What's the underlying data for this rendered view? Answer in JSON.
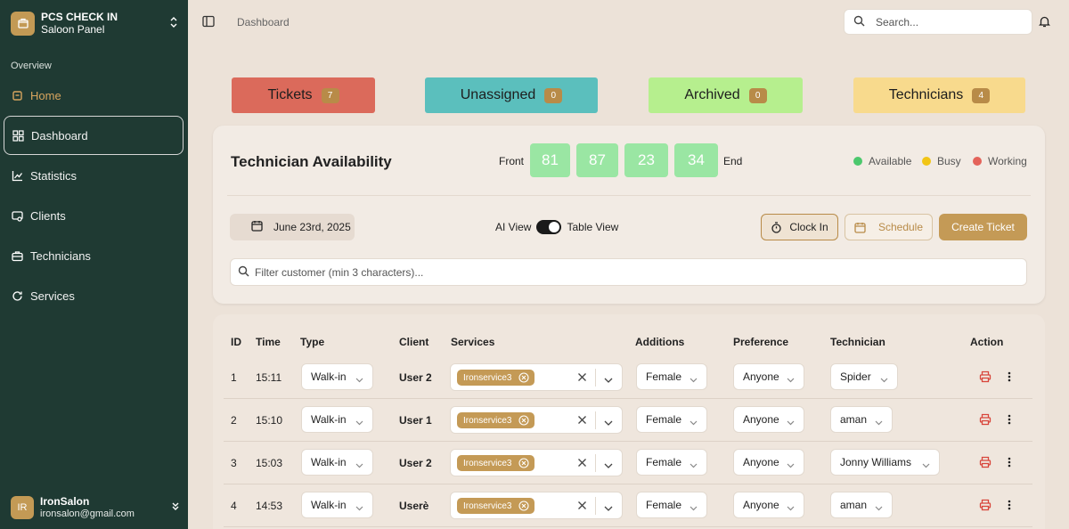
{
  "brand": {
    "title": "PCS CHECK IN",
    "subtitle": "Saloon Panel"
  },
  "sidebar": {
    "section": "Overview",
    "items": [
      {
        "label": "Home",
        "icon": "home-icon"
      },
      {
        "label": "Dashboard",
        "icon": "dashboard-icon"
      },
      {
        "label": "Statistics",
        "icon": "chart-icon"
      },
      {
        "label": "Clients",
        "icon": "clients-icon"
      },
      {
        "label": "Technicians",
        "icon": "briefcase-icon"
      },
      {
        "label": "Services",
        "icon": "services-icon"
      }
    ],
    "active": "Dashboard"
  },
  "user": {
    "initials": "IR",
    "name": "IronSalon",
    "email": "ironsalon@gmail.com"
  },
  "header": {
    "breadcrumb": "Dashboard",
    "search_placeholder": "Search..."
  },
  "stats": [
    {
      "label": "Tickets",
      "count": "7",
      "color": "#db6a5b"
    },
    {
      "label": "Unassigned",
      "count": "0",
      "color": "#5bbfbd"
    },
    {
      "label": "Archived",
      "count": "0",
      "color": "#b6ef8e"
    },
    {
      "label": "Technicians",
      "count": "4",
      "color": "#f8da8d"
    }
  ],
  "availability": {
    "title": "Technician Availability",
    "front_label": "Front",
    "end_label": "End",
    "queue": [
      "81",
      "87",
      "23",
      "34"
    ],
    "legend": [
      {
        "label": "Available",
        "color": "#4cc86d"
      },
      {
        "label": "Busy",
        "color": "#f2c515"
      },
      {
        "label": "Working",
        "color": "#e4635a"
      }
    ],
    "date": "June 23rd, 2025",
    "ai_view": "AI View",
    "table_view": "Table View",
    "clock_in": "Clock In",
    "schedule": "Schedule",
    "create_ticket": "Create Ticket",
    "filter_placeholder": "Filter customer (min 3 characters)..."
  },
  "table": {
    "headers": [
      "ID",
      "Time",
      "Type",
      "Client",
      "Services",
      "Additions",
      "Preference",
      "Technician",
      "Action"
    ],
    "rows": [
      {
        "id": "1",
        "time": "15:11",
        "type": "Walk-in",
        "client": "User 2",
        "service": "Ironservice3",
        "addition": "Female",
        "preference": "Anyone",
        "technician": "Spider"
      },
      {
        "id": "2",
        "time": "15:10",
        "type": "Walk-in",
        "client": "User 1",
        "service": "Ironservice3",
        "addition": "Female",
        "preference": "Anyone",
        "technician": "aman"
      },
      {
        "id": "3",
        "time": "15:03",
        "type": "Walk-in",
        "client": "User 2",
        "service": "Ironservice3",
        "addition": "Female",
        "preference": "Anyone",
        "technician": "Jonny Williams"
      },
      {
        "id": "4",
        "time": "14:53",
        "type": "Walk-in",
        "client": "Userè",
        "service": "Ironservice3",
        "addition": "Female",
        "preference": "Anyone",
        "technician": "aman"
      }
    ]
  }
}
